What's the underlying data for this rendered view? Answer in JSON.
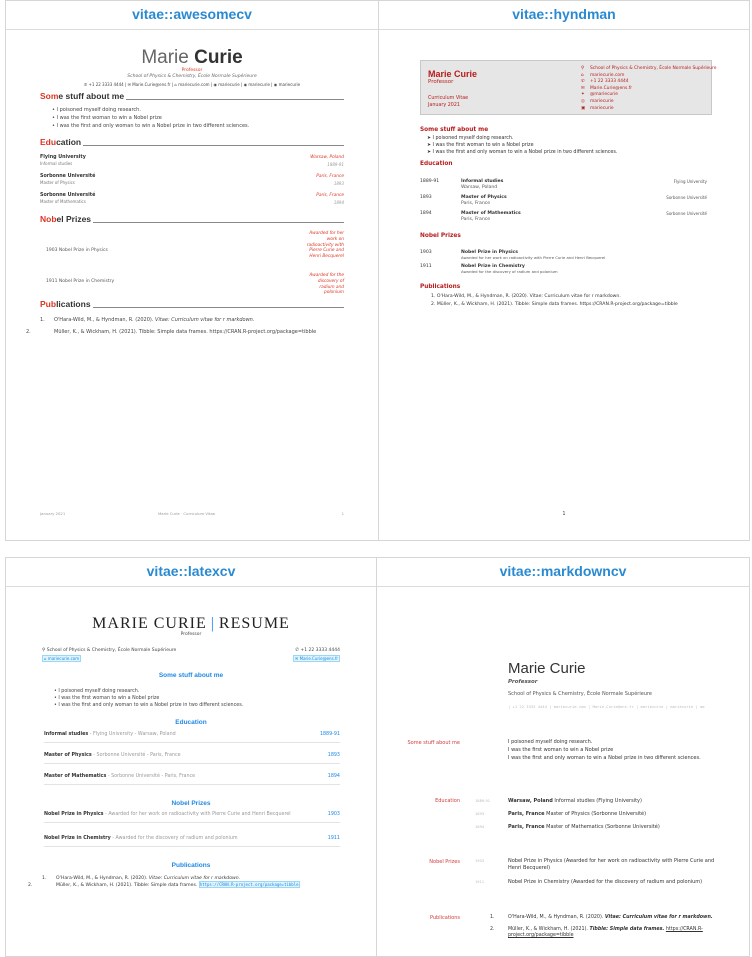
{
  "panels": {
    "awesomecv": {
      "title": "vitae::awesomecv"
    },
    "hyndman": {
      "title": "vitae::hyndman"
    },
    "latexcv": {
      "title": "vitae::latexcv"
    },
    "markdowncv": {
      "title": "vitae::markdowncv"
    }
  },
  "cv": {
    "first": "Marie",
    "last": "Curie",
    "full": "Marie Curie",
    "position": "Professor",
    "address": "School of Physics & Chemistry, École Normale Supérieure",
    "phone": "+1 22 3333 4444",
    "email": "Marie.Curie@ens.fr",
    "website": "mariecurie.com",
    "github": "mariecurie",
    "twitter": "mariecurie",
    "linkedin": "mariecurie",
    "section_about": "Some stuff about me",
    "section_about_pre": "Som",
    "section_about_post": "e stuff about me",
    "section_education": "Education",
    "section_education_pre": "Edu",
    "section_education_post": "cation",
    "section_prizes": "Nobel Prizes",
    "section_prizes_pre": "Nob",
    "section_prizes_post": "el Prizes",
    "section_pubs": "Publications",
    "section_pubs_pre": "Pub",
    "section_pubs_post": "lications",
    "about": [
      "I poisoned myself doing research.",
      "I was the first woman to win a Nobel prize",
      "I was the first and only woman to win a Nobel prize in two different sciences."
    ],
    "education": [
      {
        "title": "Informal studies",
        "inst": "Flying University",
        "where": "Warsaw, Poland",
        "when": "1889-91"
      },
      {
        "title": "Master of Physics",
        "inst": "Sorbonne Université",
        "where": "Paris, France",
        "when": "1893"
      },
      {
        "title": "Master of Mathematics",
        "inst": "Sorbonne Université",
        "where": "Paris, France",
        "when": "1894"
      }
    ],
    "prizes": [
      {
        "title": "Nobel Prize in Physics",
        "year": "1903",
        "desc": "Awarded for her work on radioactivity with Pierre Curie and Henri Becquerel"
      },
      {
        "title": "Nobel Prize in Chemistry",
        "year": "1911",
        "desc": "Awarded for the discovery of radium and polonium"
      }
    ],
    "pubs": [
      {
        "n": "1.",
        "authors": "O'Hara-Wild, M., & Hyndman, R. (2020).",
        "title": "Vitae: Curriculum vitae for r markdown."
      },
      {
        "n": "2.",
        "authors": "Müller, K., & Wickham, H. (2021).",
        "title": "Tibble: Simple data frames.",
        "url": "https://CRAN.R-project.org/package=tibble"
      }
    ]
  },
  "awesome": {
    "contact": "✆ +1 22 3333 4444  |  ✉ Marie.Curie@ens.fr  |  ⌂ mariecurie.com  |  ◉ mariecurie  |  ◉ mariecurie  |  ◉ mariecurie",
    "edu_right": [
      [
        "Warsaw, Poland",
        "1889-91"
      ],
      [
        "Paris, France",
        "1893"
      ],
      [
        "Paris, France",
        "1894"
      ]
    ],
    "edu_sub": [
      "Informal studies",
      "Master of Physics",
      "Master of Mathematics"
    ],
    "honor_right_1": "Awarded for her work on radioactivity with Pierre Curie and Henri Becquerel",
    "honor_right_2": "Awarded for the discovery of radium and polonium",
    "pub2": "Müller, K., & Wickham, H. (2021). Tibble: Simple data frames. https://CRAN.R-project.org/package=tibble",
    "foot_left": "January 2021",
    "foot_mid": "Marie Curie · Curriculum Vitae",
    "foot_right": "1"
  },
  "hyndman": {
    "cv": "Curriculum Vitae",
    "date": "January 2021",
    "contact": [
      {
        "ic": "⚲",
        "t": "School of Physics & Chemistry, École Normale Supérieure"
      },
      {
        "ic": "⌂",
        "t": "mariecurie.com"
      },
      {
        "ic": "✆",
        "t": "+1 22 3333 4444"
      },
      {
        "ic": "✉",
        "t": "Marie.Curie@ens.fr"
      },
      {
        "ic": "✦",
        "t": "@mariecurie"
      },
      {
        "ic": "◎",
        "t": "mariecurie"
      },
      {
        "ic": "▣",
        "t": "mariecurie"
      }
    ],
    "prize1_desc": "Awarded for her work on radioactivity with Pierre Curie and Henri Becquerel",
    "prize2_desc": "Awarded for the discovery of radium and polonium",
    "pub1": "1. O'Hara-Wild, M., & Hyndman, R. (2020). Vitae: Curriculum vitae for r markdown.",
    "pub2": "2. Müller, K., & Wickham, H. (2021). Tibble: Simple data frames. https://CRAN.R-project.org/package=tibble",
    "page": "1"
  },
  "latex": {
    "title_left": "MARIE CURIE",
    "title_sep": "|",
    "title_right": "RESUME",
    "addr": "⚲ School of Physics & Chemistry, École Normale Supérieure",
    "chip_left": "⌂ mariecurie.com",
    "phone": "✆ +1 22 3333 4444",
    "chip_right": "✉ Marie.Curie@ens.fr",
    "edu": [
      {
        "b": "Informal studies",
        "g": " - Flying University - Warsaw, Poland",
        "yr": "1889-91"
      },
      {
        "b": "Master of Physics",
        "g": " - Sorbonne Université - Paris, France",
        "yr": "1893"
      },
      {
        "b": "Master of Mathematics",
        "g": " - Sorbonne Université - Paris, France",
        "yr": "1894"
      }
    ],
    "prize": [
      {
        "b": "Nobel Prize in Physics",
        "g": " - Awarded for her work on radioactivity with Pierre Curie and Henri Becquerel",
        "yr": "1903"
      },
      {
        "b": "Nobel Prize in Chemistry",
        "g": " - Awarded for the discovery of radium and polonium",
        "yr": "1911"
      }
    ],
    "pub2_pre": "Müller, K., & Wickham, H. (2021). Tibble: Simple data frames.",
    "pub2_url": "https://CRAN.R-project.org/package=tibble"
  },
  "markdown": {
    "contact": "|  +1 22 3333 4444  |  mariecurie.com  |  Marie.Curie@ens.fr  |  mariecurie  |  mariecurie  |  ma",
    "edu": [
      {
        "yr": "1889-91",
        "b": "Warsaw, Poland",
        "t": " Informal studies (Flying University)"
      },
      {
        "yr": "1893",
        "b": "Paris, France",
        "t": " Master of Physics (Sorbonne Université)"
      },
      {
        "yr": "1894",
        "b": "Paris, France",
        "t": " Master of Mathematics (Sorbonne Université)"
      }
    ],
    "prize": [
      {
        "yr": "1903",
        "t": "Nobel Prize in Physics (Awarded for her work on radioactivity with Pierre Curie and Henri Becquerel)"
      },
      {
        "yr": "1911",
        "t": "Nobel Prize in Chemistry (Awarded for the discovery of radium and polonium)"
      }
    ],
    "pub2_pre": "Müller, K., & Wickham, H. (2021).",
    "pub2_title": "Tibble: Simple data frames.",
    "pub2_url": "https://CRAN.R-project.org/package=tibble"
  }
}
